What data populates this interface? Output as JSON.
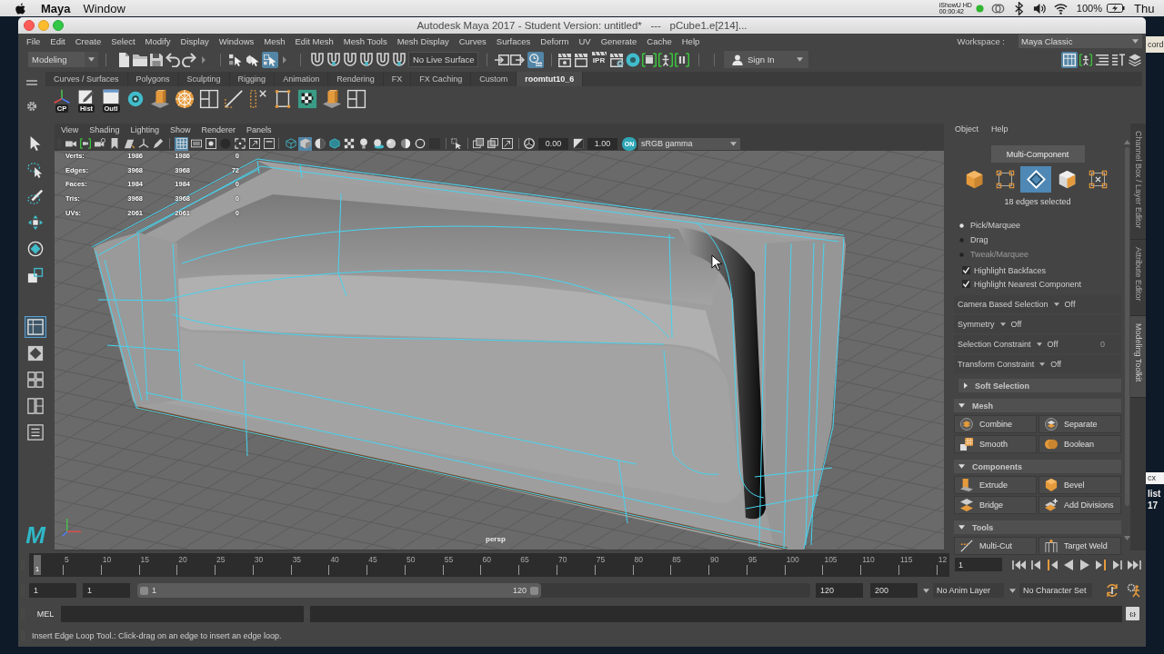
{
  "mac_menubar": {
    "app": "Maya",
    "menus": [
      "Window"
    ],
    "recorder": {
      "name": "iShowU HD",
      "time": "00:00:42"
    },
    "battery": "100%",
    "clock": "Thu"
  },
  "desktop_fragments": [
    {
      "text": "cord",
      "kind": "tile"
    },
    {
      "text": "cx",
      "kind": "tile"
    },
    {
      "text": "list",
      "kind": "caption"
    },
    {
      "text": "17",
      "kind": "caption"
    }
  ],
  "window": {
    "title": "Autodesk Maya 2017 - Student Version: untitled*   ---   pCube1.e[214]..."
  },
  "menubar": {
    "items": [
      "File",
      "Edit",
      "Create",
      "Select",
      "Modify",
      "Display",
      "Windows",
      "Mesh",
      "Edit Mesh",
      "Mesh Tools",
      "Mesh Display",
      "Curves",
      "Surfaces",
      "Deform",
      "UV",
      "Generate",
      "Cache",
      "Help"
    ],
    "workspace_label": "Workspace :",
    "workspace": "Maya Classic"
  },
  "status_line": {
    "menu_set": "Modeling",
    "select_modes": [
      {
        "selected": false
      },
      {
        "selected": false
      },
      {
        "selected": true
      }
    ],
    "live_surface": "No Live Surface",
    "history": {
      "on": true
    },
    "ipr_label": "IPR",
    "sign_in": "Sign In",
    "panel_toggles": [
      {
        "selected": true
      },
      {
        "selected": false
      },
      {
        "selected": false
      },
      {
        "selected": false
      },
      {
        "selected": false
      }
    ]
  },
  "shelf": {
    "tabs": [
      {
        "label": "Curves / Surfaces",
        "selected": false
      },
      {
        "label": "Polygons",
        "selected": false
      },
      {
        "label": "Sculpting",
        "selected": false
      },
      {
        "label": "Rigging",
        "selected": false
      },
      {
        "label": "Animation",
        "selected": false
      },
      {
        "label": "Rendering",
        "selected": false
      },
      {
        "label": "FX",
        "selected": false
      },
      {
        "label": "FX Caching",
        "selected": false
      },
      {
        "label": "Custom",
        "selected": false
      },
      {
        "label": "roomtut10_6",
        "selected": true
      }
    ],
    "labeled_tools": [
      {
        "label": "CP"
      },
      {
        "label": "Hist"
      },
      {
        "label": "Outl"
      }
    ]
  },
  "toolbox": {
    "layouts": [
      {
        "selected": true
      },
      {
        "selected": false
      },
      {
        "selected": false
      },
      {
        "selected": false
      },
      {
        "selected": false
      }
    ],
    "logo": "M"
  },
  "viewport": {
    "menus": [
      "View",
      "Shading",
      "Lighting",
      "Show",
      "Renderer",
      "Panels"
    ],
    "display_toggles": [
      {
        "selected": true
      },
      {
        "selected": false
      },
      {
        "selected": false
      },
      {
        "selected": false
      },
      {
        "selected": false
      },
      {
        "selected": false
      },
      {
        "selected": false
      }
    ],
    "shading_toggles": [
      {
        "selected": false
      },
      {
        "selected": true
      },
      {
        "selected": false
      },
      {
        "selected": false
      },
      {
        "selected": false
      },
      {
        "selected": false
      },
      {
        "selected": false
      }
    ],
    "exposure": "0.00",
    "gamma": "1.00",
    "color_management": "ON",
    "color_space": "sRGB gamma",
    "hud": [
      {
        "label": "Verts:",
        "values": [
          "1986",
          "1986",
          "0"
        ]
      },
      {
        "label": "Edges:",
        "values": [
          "3968",
          "3968",
          "72"
        ]
      },
      {
        "label": "Faces:",
        "values": [
          "1984",
          "1984",
          "0"
        ]
      },
      {
        "label": "Tris:",
        "values": [
          "3968",
          "3968",
          "0"
        ]
      },
      {
        "label": "UVs:",
        "values": [
          "2061",
          "2061",
          "0"
        ]
      }
    ],
    "camera": "persp"
  },
  "toolkit": {
    "menus": [
      "Object",
      "Help"
    ],
    "mode_button": "Multi-Component",
    "component_modes": [
      {
        "selected": false
      },
      {
        "selected": false
      },
      {
        "selected": true
      },
      {
        "selected": false
      },
      {
        "selected": false
      }
    ],
    "selection_info": "18 edges selected",
    "pick_modes": [
      {
        "label": "Pick/Marquee",
        "selected": true,
        "disabled": false
      },
      {
        "label": "Drag",
        "selected": false,
        "disabled": false
      },
      {
        "label": "Tweak/Marquee",
        "selected": false,
        "disabled": true
      }
    ],
    "options": [
      {
        "label": "Highlight Backfaces",
        "checked": true
      },
      {
        "label": "Highlight Nearest Component",
        "checked": true
      }
    ],
    "settings": [
      {
        "label": "Camera Based Selection",
        "value": "Off"
      },
      {
        "label": "Symmetry",
        "value": "Off"
      },
      {
        "label": "Selection Constraint",
        "value": "Off",
        "count": "0"
      },
      {
        "label": "Transform Constraint",
        "value": "Off"
      }
    ],
    "sections": [
      {
        "title": "Soft Selection",
        "expanded": false
      },
      {
        "title": "Mesh",
        "expanded": true,
        "tools": [
          "Combine",
          "Separate",
          "Smooth",
          "Boolean"
        ]
      },
      {
        "title": "Components",
        "expanded": true,
        "tools": [
          "Extrude",
          "Bevel",
          "Bridge",
          "Add Divisions"
        ]
      },
      {
        "title": "Tools",
        "expanded": true,
        "tools": [
          "Multi-Cut",
          "Target Weld"
        ]
      }
    ]
  },
  "side_tabs": [
    {
      "label": "Channel Box / Layer Editor",
      "selected": false
    },
    {
      "label": "Attribute Editor",
      "selected": false
    },
    {
      "label": "Modeling Toolkit",
      "selected": true
    }
  ],
  "timeline": {
    "labels": [
      "5",
      "10",
      "15",
      "20",
      "25",
      "30",
      "35",
      "40",
      "45",
      "50",
      "55",
      "60",
      "65",
      "70",
      "75",
      "80",
      "85",
      "90",
      "95",
      "100",
      "105",
      "110",
      "115",
      "12"
    ],
    "current_frame": "1",
    "frame_field": "1"
  },
  "range": {
    "start": "1",
    "playback_start": "1",
    "slider_start": "1",
    "slider_end": "120",
    "level": 0.6,
    "playback_end": "120",
    "end": "200",
    "anim_layer": "No Anim Layer",
    "character_set": "No Character Set"
  },
  "command_line": {
    "language": "MEL",
    "script_button": "{;}"
  },
  "help_line": "Insert Edge Loop Tool.: Click-drag on an edge to insert an edge loop."
}
